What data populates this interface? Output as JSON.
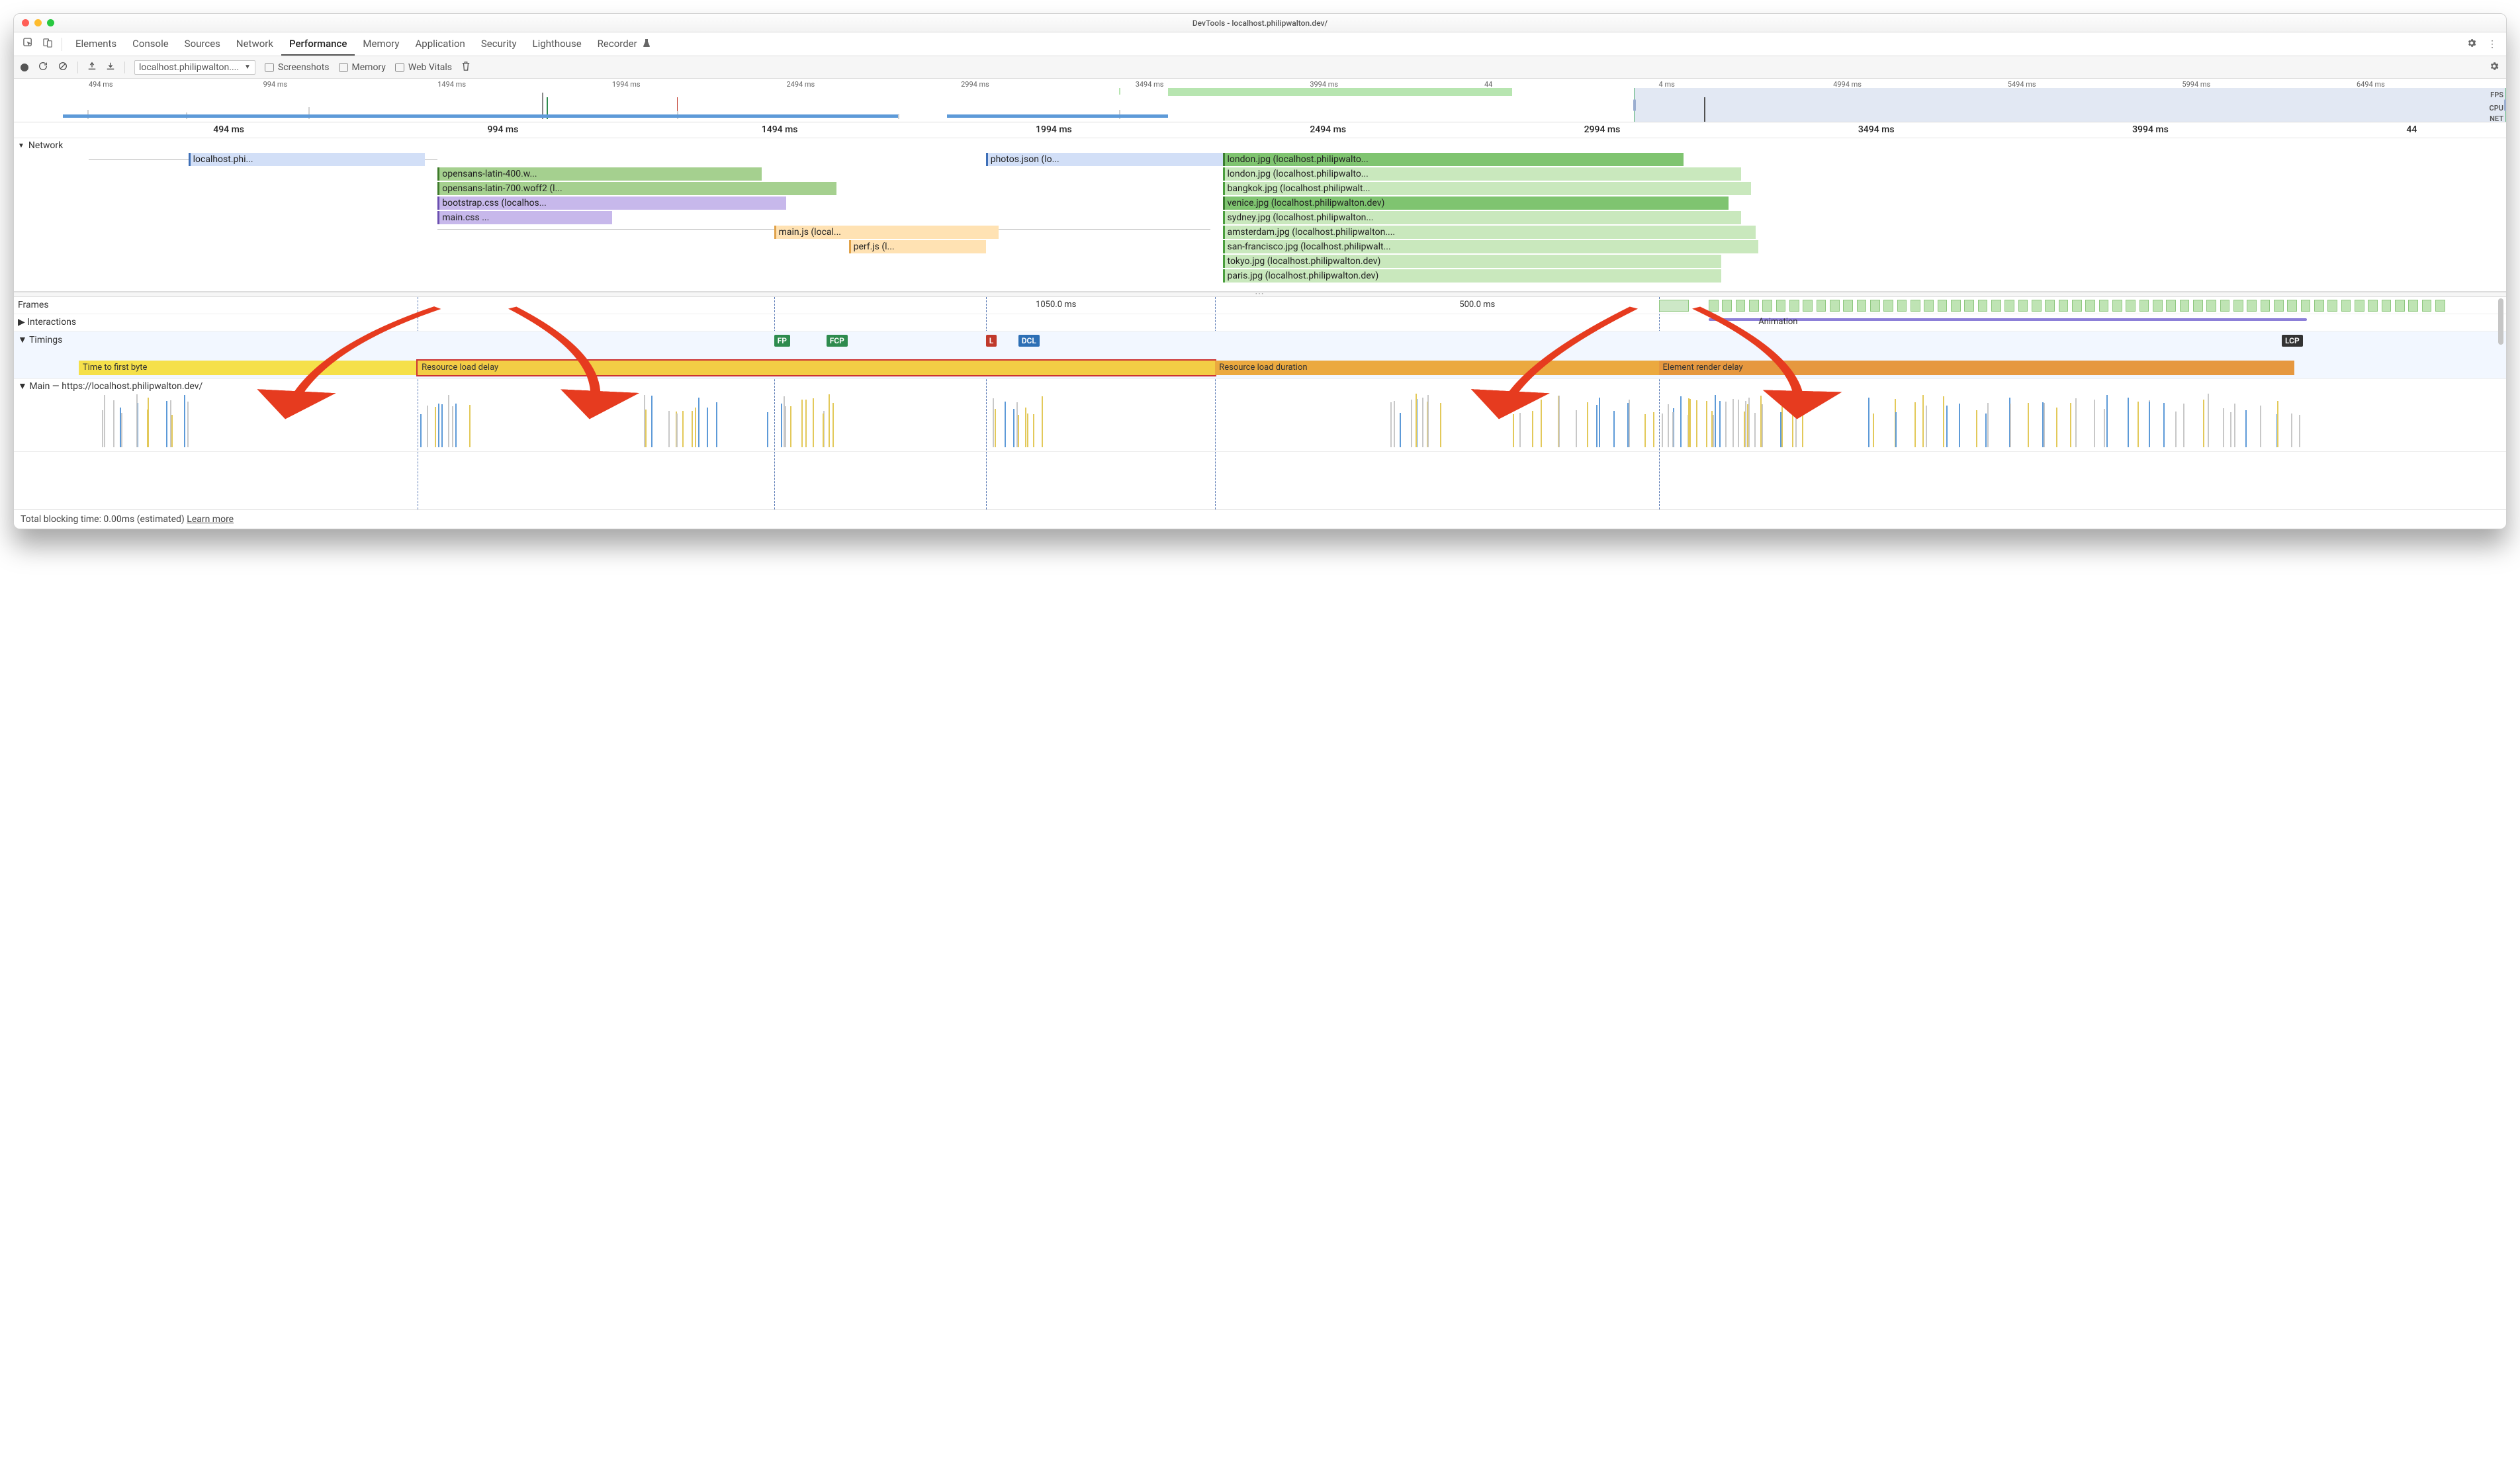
{
  "window": {
    "title": "DevTools - localhost.philipwalton.dev/"
  },
  "tabs": {
    "items": [
      "Elements",
      "Console",
      "Sources",
      "Network",
      "Performance",
      "Memory",
      "Application",
      "Security",
      "Lighthouse",
      "Recorder"
    ],
    "active": "Performance"
  },
  "toolbar": {
    "profile_select": "localhost.philipwalton....",
    "chk_screenshots": "Screenshots",
    "chk_memory": "Memory",
    "chk_web_vitals": "Web Vitals"
  },
  "overview": {
    "ticks": [
      "494 ms",
      "994 ms",
      "1494 ms",
      "1994 ms",
      "2494 ms",
      "2994 ms",
      "3494 ms",
      "3994 ms",
      "44",
      "4 ms",
      "4994 ms",
      "5494 ms",
      "5994 ms",
      "6494 ms"
    ],
    "lanes": {
      "fps": "FPS",
      "cpu": "CPU",
      "net": "NET"
    }
  },
  "ruler": {
    "ticks": [
      "494 ms",
      "994 ms",
      "1494 ms",
      "1994 ms",
      "2494 ms",
      "2994 ms",
      "3494 ms",
      "3994 ms",
      "44"
    ]
  },
  "network": {
    "label": "Network",
    "frames_label": "Frames",
    "interactions_label": "Interactions",
    "timings_label": "Timings",
    "main_label": "Main — https://localhost.philipwalton.dev/",
    "requests": [
      {
        "id": "doc",
        "row": 0,
        "left_pct": 7.0,
        "width_pct": 9.5,
        "cls": "doc",
        "label": "localhost.phi..."
      },
      {
        "id": "f1",
        "row": 1,
        "left_pct": 17.0,
        "width_pct": 13.0,
        "cls": "font",
        "label": "opensans-latin-400.w..."
      },
      {
        "id": "f2",
        "row": 2,
        "left_pct": 17.0,
        "width_pct": 16.0,
        "cls": "font",
        "label": "opensans-latin-700.woff2 (l..."
      },
      {
        "id": "c1",
        "row": 3,
        "left_pct": 17.0,
        "width_pct": 14.0,
        "cls": "css",
        "label": "bootstrap.css (localhos..."
      },
      {
        "id": "c2",
        "row": 4,
        "left_pct": 17.0,
        "width_pct": 7.0,
        "cls": "css",
        "label": "main.css ..."
      },
      {
        "id": "j1",
        "row": 5,
        "left_pct": 30.5,
        "width_pct": 9.0,
        "cls": "js",
        "label": "main.js (local..."
      },
      {
        "id": "j2",
        "row": 6,
        "left_pct": 33.5,
        "width_pct": 5.5,
        "cls": "js",
        "label": "perf.js (l..."
      },
      {
        "id": "pj",
        "row": 0,
        "left_pct": 39.0,
        "width_pct": 9.5,
        "cls": "json",
        "label": "photos.json (lo..."
      },
      {
        "id": "i1",
        "row": 0,
        "left_pct": 48.5,
        "width_pct": 18.5,
        "cls": "img d",
        "label": "london.jpg (localhost.philipwalto..."
      },
      {
        "id": "i1b",
        "row": 1,
        "left_pct": 48.5,
        "width_pct": 20.8,
        "cls": "img",
        "label": "london.jpg (localhost.philipwalto..."
      },
      {
        "id": "i2",
        "row": 2,
        "left_pct": 48.5,
        "width_pct": 21.2,
        "cls": "img",
        "label": "bangkok.jpg (localhost.philipwalt..."
      },
      {
        "id": "i3",
        "row": 3,
        "left_pct": 48.5,
        "width_pct": 20.3,
        "cls": "img d",
        "label": "venice.jpg (localhost.philipwalton.dev)"
      },
      {
        "id": "i4",
        "row": 4,
        "left_pct": 48.5,
        "width_pct": 20.8,
        "cls": "img",
        "label": "sydney.jpg (localhost.philipwalton..."
      },
      {
        "id": "i5",
        "row": 5,
        "left_pct": 48.5,
        "width_pct": 21.4,
        "cls": "img",
        "label": "amsterdam.jpg (localhost.philipwalton...."
      },
      {
        "id": "i6",
        "row": 6,
        "left_pct": 48.5,
        "width_pct": 21.5,
        "cls": "img",
        "label": "san-francisco.jpg (localhost.philipwalt..."
      },
      {
        "id": "i7",
        "row": 7,
        "left_pct": 48.5,
        "width_pct": 20.0,
        "cls": "img",
        "label": "tokyo.jpg (localhost.philipwalton.dev)"
      },
      {
        "id": "i8",
        "row": 8,
        "left_pct": 48.5,
        "width_pct": 20.0,
        "cls": "img",
        "label": "paris.jpg (localhost.philipwalton.dev)"
      }
    ]
  },
  "frames": {
    "value_left": "1050.0 ms",
    "value_right": "500.0 ms",
    "animation_label": "Animation"
  },
  "timings": {
    "flags": {
      "fp": "FP",
      "fcp": "FCP",
      "l": "L",
      "dcl": "DCL",
      "lcp": "LCP"
    },
    "segments": {
      "ttfb": "Time to first byte",
      "rld": "Resource load delay",
      "rldur": "Resource load duration",
      "erd": "Element render delay"
    }
  },
  "footer": {
    "tbt": "Total blocking time: 0.00ms (estimated)",
    "learn": "Learn more"
  }
}
